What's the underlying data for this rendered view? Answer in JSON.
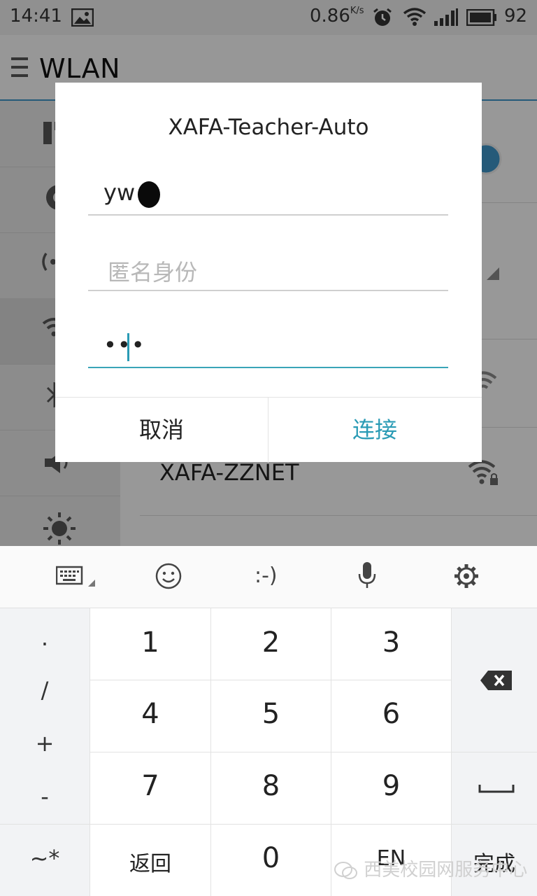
{
  "status_bar": {
    "time": "14:41",
    "net_speed": "0.86",
    "net_speed_unit": "K/s",
    "battery_level": "92"
  },
  "app_bar": {
    "title": "WLAN"
  },
  "background": {
    "visible_network": "XAFA-ZZNET"
  },
  "dialog": {
    "title": "XAFA-Teacher-Auto",
    "identity_value": "yw",
    "anonymous_identity_placeholder": "匿名身份",
    "password_masked": "•••",
    "cancel_label": "取消",
    "connect_label": "连接",
    "accent_color": "#2a9bb5"
  },
  "keyboard": {
    "toolbar": {
      "icons": [
        "keyboard-switch-icon",
        "emoji-icon",
        "emoticon-icon",
        "microphone-icon",
        "settings-icon"
      ],
      "emoticon_label": ":-)"
    },
    "left_symbols": [
      "·",
      "/",
      "+",
      "-"
    ],
    "tilde_key": "~*",
    "digits": [
      "1",
      "2",
      "3",
      "4",
      "5",
      "6",
      "7",
      "8",
      "9"
    ],
    "return_label": "返回",
    "zero_label": "0",
    "en_label": "EN",
    "done_label": "完成"
  },
  "watermark": {
    "text": "西美校园网服务中心"
  }
}
